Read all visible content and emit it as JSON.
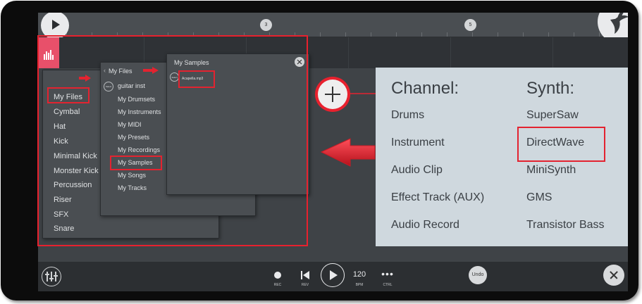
{
  "ruler": {
    "markers": [
      "3",
      "5"
    ]
  },
  "file_lists": {
    "packs_list": [
      "My Files",
      "Cymbal",
      "Hat",
      "Kick",
      "Minimal Kick",
      "Monster Kick",
      "Percussion",
      "Riser",
      "SFX",
      "Snare"
    ],
    "my_files_panel": {
      "title": "My Files",
      "select_label": "Select",
      "first_item": "guitar inst",
      "items": [
        "My Drumsets",
        "My Instruments",
        "My MIDI",
        "My Presets",
        "My Recordings",
        "My Samples",
        "My Songs",
        "My Tracks"
      ]
    },
    "my_samples_panel": {
      "title": "My Samples",
      "select_label": "Select",
      "file": "Acapella.mp3"
    }
  },
  "add_popup": {
    "channel_header": "Channel:",
    "synth_header": "Synth:",
    "channels": [
      "Drums",
      "Instrument",
      "Audio Clip",
      "Effect Track (AUX)",
      "Audio Record"
    ],
    "synths": [
      "SuperSaw",
      "DirectWave",
      "MiniSynth",
      "GMS",
      "Transistor Bass"
    ]
  },
  "transport": {
    "rec": "REC",
    "rev": "REV",
    "bpm_value": "120",
    "bpm": "BPM",
    "ctrl_icon": "•••",
    "ctrl": "CTRL",
    "undo": "Undo"
  },
  "colors": {
    "annotation_red": "#e32330",
    "pattern_pink": "#e8506a",
    "popup_bg": "#cfd8de",
    "panel_bg": "#4a4e52"
  },
  "icons": [
    "play-icon",
    "fl-logo",
    "mixer-icon",
    "record-icon",
    "rewind-icon",
    "close-icon",
    "plus-icon"
  ]
}
